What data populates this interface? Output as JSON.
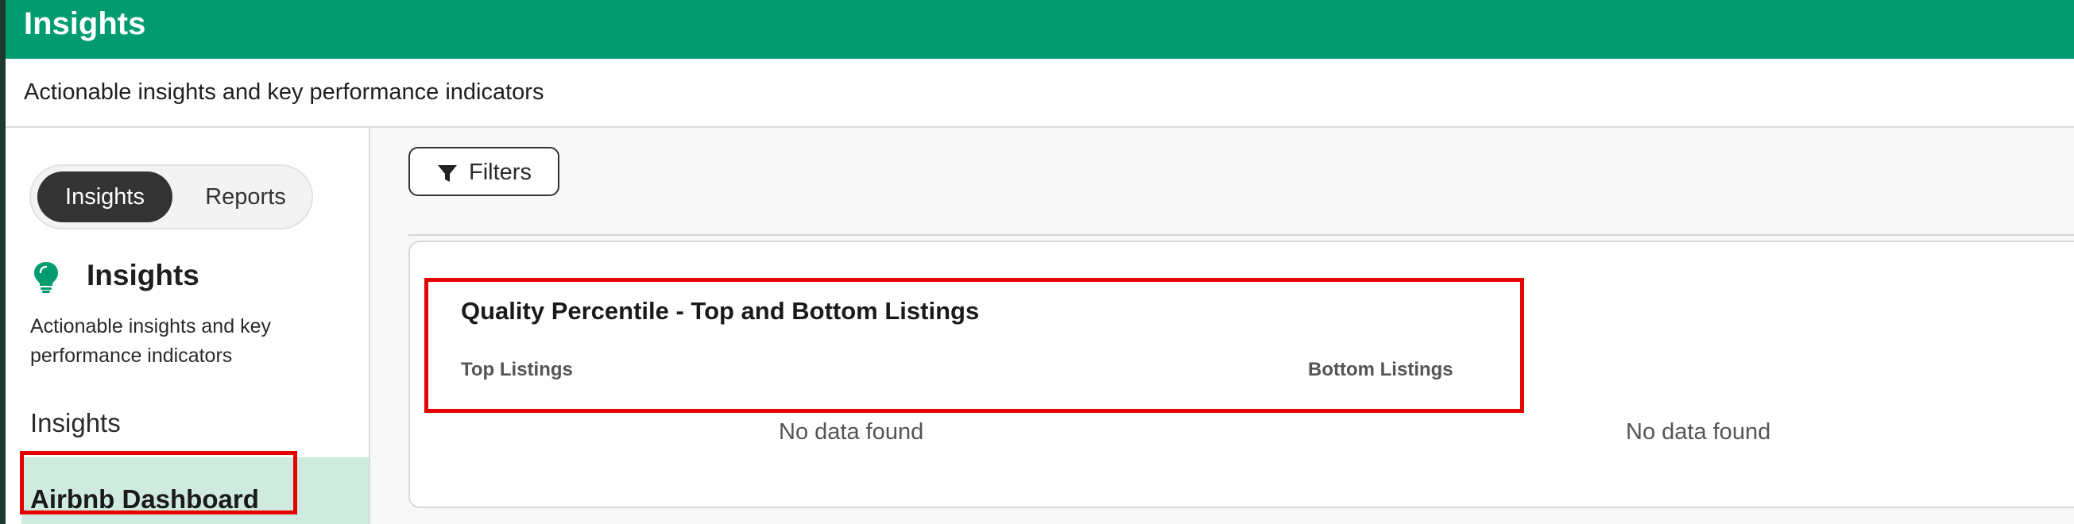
{
  "header": {
    "title": "Insights",
    "subtitle": "Actionable insights and key performance indicators"
  },
  "sidebar": {
    "toggle": {
      "active": "Insights",
      "inactive": "Reports"
    },
    "heading": "Insights",
    "description": "Actionable insights and key performance indicators",
    "section_label": "Insights",
    "selected_item": "Airbnb Dashboard"
  },
  "main": {
    "filters_label": "Filters",
    "card": {
      "title": "Quality Percentile - Top and Bottom Listings",
      "top_label": "Top Listings",
      "bottom_label": "Bottom Listings",
      "top_empty": "No data found",
      "bottom_empty": "No data found"
    }
  },
  "colors": {
    "brand": "#009b6e",
    "selected": "#cfeadf",
    "highlight": "#e60000"
  },
  "icons": {
    "bulb": "lightbulb-icon",
    "filter": "filter-icon"
  }
}
